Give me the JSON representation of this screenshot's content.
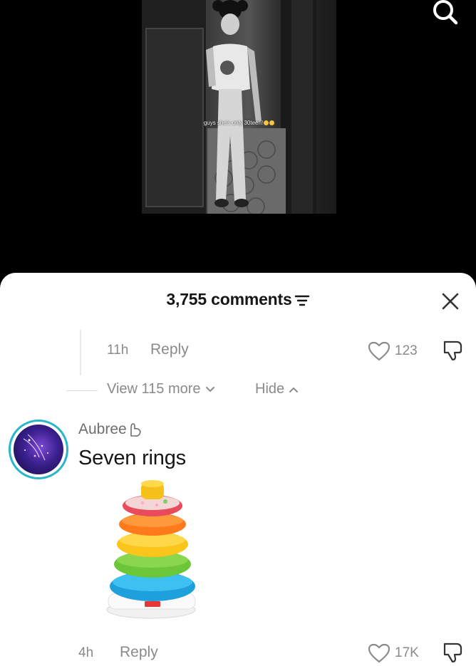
{
  "video": {
    "caption": "guys she's only 30teen!"
  },
  "comments_sheet": {
    "count_label": "3,755 comments",
    "reply_item": {
      "time": "11h",
      "reply_label": "Reply",
      "likes": "123"
    },
    "view_more_label": "View 115 more",
    "hide_label": "Hide",
    "comment": {
      "username": "Aubree",
      "text": "Seven rings",
      "time": "4h",
      "reply_label": "Reply",
      "likes": "17K"
    }
  },
  "colors": {
    "avatar_ring": "#2ab6c8",
    "muted_text": "#8a8a8a",
    "primary_text": "#161616"
  },
  "icons": [
    "search-icon",
    "filter-icon",
    "close-icon",
    "heart-icon",
    "dislike-icon",
    "chevron-down-icon",
    "chevron-up-icon",
    "hand-emoji-icon"
  ]
}
